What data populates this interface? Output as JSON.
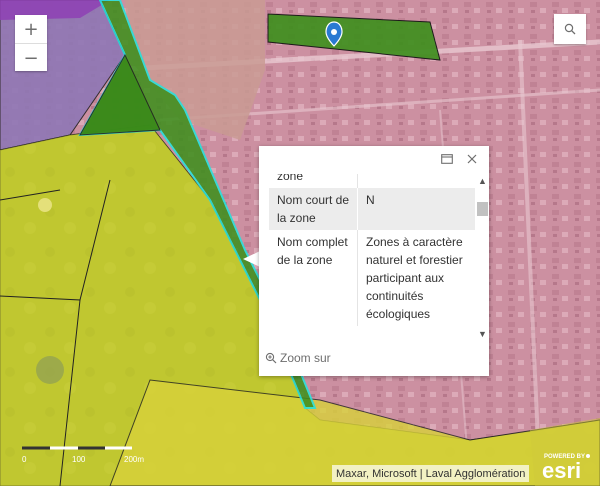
{
  "zoom": {
    "in_label": "+",
    "out_label": "−"
  },
  "popup": {
    "rows": [
      {
        "label": "Nom court de la zone",
        "value": "N"
      },
      {
        "label": "Nom complet de la zone",
        "value": "Zones à caractère naturel et forestier participant aux continuités écologiques"
      }
    ],
    "partial_top_label": "zone",
    "zoom_to_label": "Zoom sur"
  },
  "scalebar": {
    "labels": [
      "0",
      "100",
      "200m"
    ]
  },
  "attribution": "Maxar, Microsoft | Laval Agglomération",
  "logo": {
    "top_text": "POWERED BY",
    "main_text": "esri"
  },
  "colors": {
    "urban_zone": "#c98a9e",
    "natural_zone": "#3f8f1e",
    "agri_zone": "#c9cf2a",
    "agri_yellow": "#d8c735",
    "purple_zone": "#8e6aa8",
    "highlight": "#25e2de",
    "marker": "#2a7ad2"
  }
}
